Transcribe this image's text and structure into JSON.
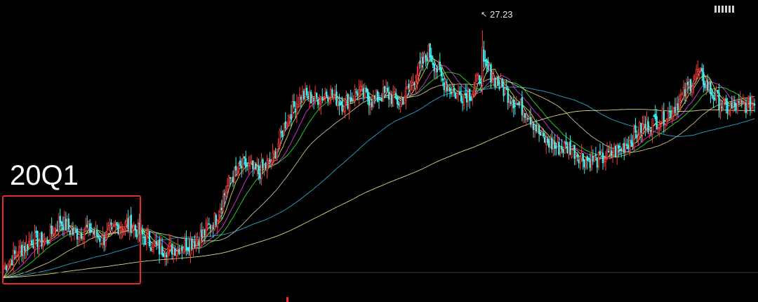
{
  "annotation": {
    "period_label": "20Q1",
    "peak_value_label": "27.23"
  },
  "colors": {
    "background": "#000000",
    "up_candle": "#ff3b3b",
    "down_candle": "#3ff0f0",
    "highlight_box": "#e52b2b",
    "ma_lines": [
      "#ffffff",
      "#ffff33",
      "#ff40ff",
      "#33ff33",
      "#f0e0a0",
      "#33c0f0",
      "#ffff99"
    ]
  },
  "icons": {
    "settings": "settings-sliders-icon"
  },
  "chart_data": {
    "type": "candlestick",
    "title": "",
    "xlabel": "",
    "ylabel": "",
    "grid": false,
    "ylim": [
      9,
      28.5
    ],
    "peak": 27.23,
    "close_path_anchors": [
      [
        0,
        10.3
      ],
      [
        10,
        11.3
      ],
      [
        20,
        12.2
      ],
      [
        30,
        12.1
      ],
      [
        40,
        13.6
      ],
      [
        50,
        12.6
      ],
      [
        60,
        13.0
      ],
      [
        70,
        12.2
      ],
      [
        80,
        13.2
      ],
      [
        90,
        13.3
      ],
      [
        100,
        12.3
      ],
      [
        110,
        11.5
      ],
      [
        120,
        11.6
      ],
      [
        130,
        11.9
      ],
      [
        140,
        12.5
      ],
      [
        150,
        13.8
      ],
      [
        160,
        16.6
      ],
      [
        170,
        17.6
      ],
      [
        180,
        17.0
      ],
      [
        190,
        18.0
      ],
      [
        200,
        20.9
      ],
      [
        210,
        22.6
      ],
      [
        220,
        22.3
      ],
      [
        230,
        22.8
      ],
      [
        240,
        21.9
      ],
      [
        250,
        22.9
      ],
      [
        260,
        22.2
      ],
      [
        270,
        22.7
      ],
      [
        280,
        22.0
      ],
      [
        290,
        23.8
      ],
      [
        300,
        25.7
      ],
      [
        310,
        23.6
      ],
      [
        320,
        22.6
      ],
      [
        330,
        22.7
      ],
      [
        340,
        24.6
      ],
      [
        350,
        23.3
      ],
      [
        360,
        22.2
      ],
      [
        370,
        21.3
      ],
      [
        380,
        19.5
      ],
      [
        390,
        18.8
      ],
      [
        400,
        18.8
      ],
      [
        410,
        18.0
      ],
      [
        420,
        17.9
      ],
      [
        430,
        18.4
      ],
      [
        440,
        19.1
      ],
      [
        450,
        20.2
      ],
      [
        460,
        20.7
      ],
      [
        470,
        21.3
      ],
      [
        480,
        22.6
      ],
      [
        490,
        24.3
      ],
      [
        500,
        22.7
      ],
      [
        510,
        21.6
      ],
      [
        520,
        21.8
      ],
      [
        530,
        22.0
      ]
    ],
    "candles": []
  }
}
